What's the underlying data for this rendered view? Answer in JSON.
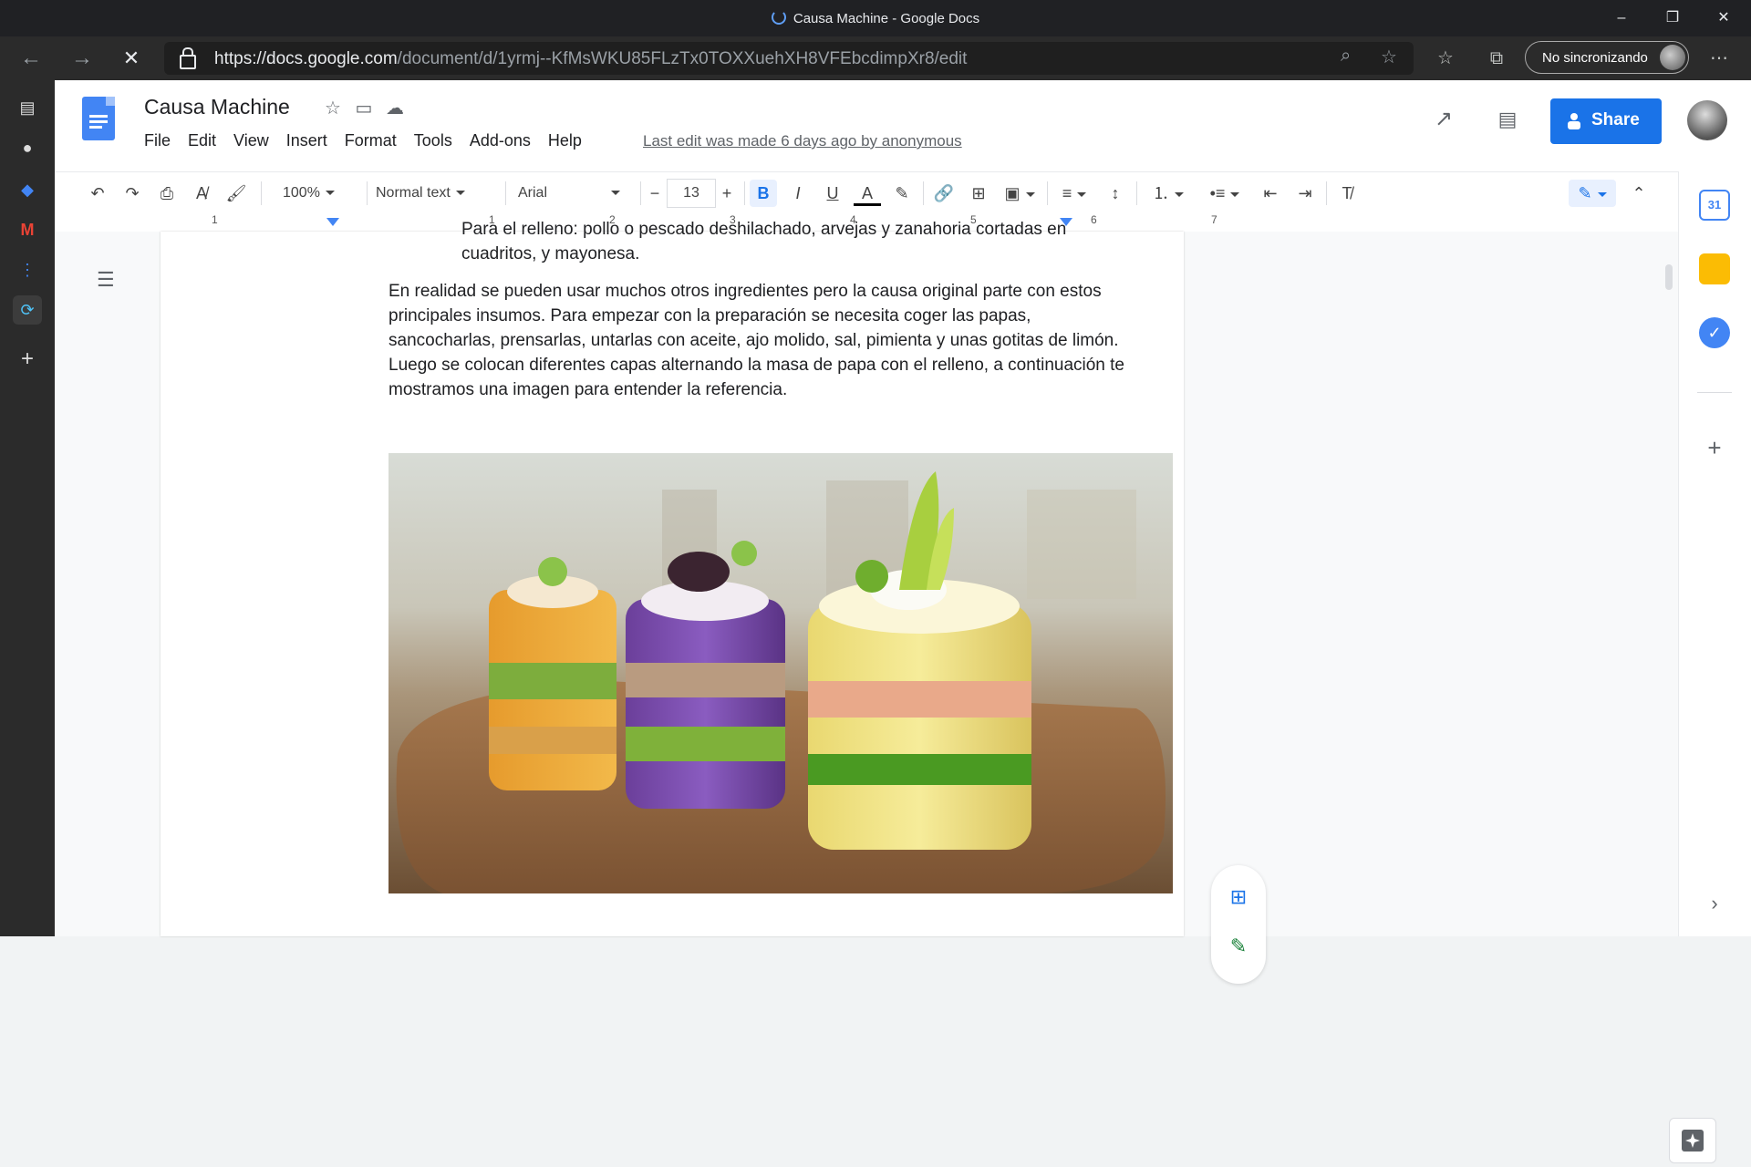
{
  "window": {
    "title": "Causa Machine - Google Docs",
    "minimize": "–",
    "restore": "❐",
    "close": "✕"
  },
  "browser": {
    "url_host": "https://docs.google.com",
    "url_path": "/document/d/1yrmj--KfMsWKU85FLzTx0TOXXuehXH8VFEbcdimpXr8/edit",
    "sync_label": "No sincronizando"
  },
  "docs": {
    "title": "Causa Machine",
    "menu": [
      "File",
      "Edit",
      "View",
      "Insert",
      "Format",
      "Tools",
      "Add-ons",
      "Help"
    ],
    "last_edit": "Last edit was made 6 days ago by anonymous",
    "share_label": "Share"
  },
  "toolbar": {
    "zoom": "100%",
    "style": "Normal text",
    "font": "Arial",
    "font_size": "13",
    "bold": "B",
    "italic": "I",
    "underline": "U",
    "text_color": "A"
  },
  "ruler": {
    "marks": [
      "1",
      "1",
      "2",
      "3",
      "4",
      "5",
      "6",
      "7"
    ]
  },
  "document": {
    "partial_line_1": "Para el relleno: pollo o pescado deshilachado, arvejas y zanahoria cortadas en",
    "partial_line_2": "cuadritos, y mayonesa.",
    "paragraph_lines": [
      "En realidad se pueden usar muchos otros ingredientes pero la causa original parte con estos",
      "principales insumos. Para empezar con la preparación se necesita coger las papas,",
      "sancocharlas, prensarlas, untarlas con aceite, ajo molido, sal, pimienta y unas gotitas de limón.",
      "Luego se colocan diferentes capas alternando la masa de papa con el relleno, a continuación te",
      "mostramos una imagen para entender la referencia."
    ]
  },
  "colors": {
    "accent": "#1a73e8",
    "docs_blue": "#4285f4",
    "chrome_dark": "#202124"
  }
}
